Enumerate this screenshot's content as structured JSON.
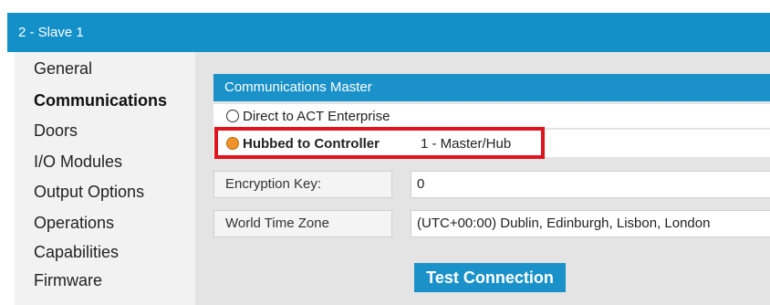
{
  "window": {
    "title": "2 - Slave 1"
  },
  "sidebar": {
    "items": [
      {
        "label": "General",
        "active": false
      },
      {
        "label": "Communications",
        "active": true
      },
      {
        "label": "Doors",
        "active": false
      },
      {
        "label": "I/O Modules",
        "active": false
      },
      {
        "label": "Output Options",
        "active": false
      },
      {
        "label": "Operations",
        "active": false
      },
      {
        "label": "Capabilities",
        "active": false
      },
      {
        "label": "Firmware",
        "active": false
      }
    ]
  },
  "communications": {
    "section_title": "Communications Master",
    "options": [
      {
        "label": "Direct to ACT Enterprise",
        "selected": false
      },
      {
        "label": "Hubbed to Controller",
        "selected": true,
        "value": "1 - Master/Hub"
      }
    ],
    "fields": [
      {
        "label": "Encryption Key:",
        "value": "0"
      },
      {
        "label": "World Time Zone",
        "value": "(UTC+00:00) Dublin, Edinburgh, Lisbon, London"
      }
    ],
    "test_button_label": "Test Connection",
    "colors": {
      "title_bar": "#1390c8",
      "section_header": "#1a92c9",
      "highlight_border": "#e0141c",
      "radio_selected": "#f0932b"
    }
  }
}
